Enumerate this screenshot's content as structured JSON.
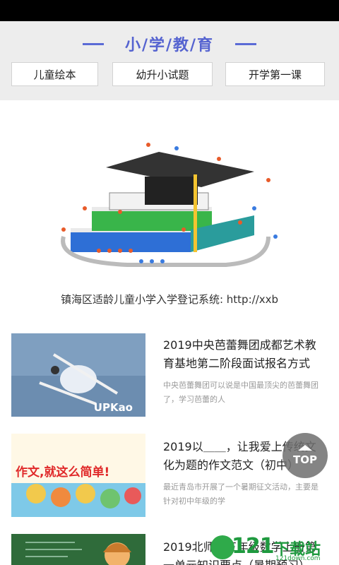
{
  "header": {
    "title": "小/学/教/育",
    "categories": [
      {
        "label": "儿童绘本"
      },
      {
        "label": "幼升小试题"
      },
      {
        "label": "开学第一课"
      }
    ]
  },
  "banner": {
    "caption": "镇海区适龄儿童小学入学登记系统: http://xxb"
  },
  "articles": [
    {
      "title": "2019中央芭蕾舞团成都艺术教育基地第二阶段面试报名方式",
      "desc": "中央芭蕾舞团可以说是中国最顶尖的芭蕾舞团了，学习芭蕾的人",
      "thumb_text": "UPKao"
    },
    {
      "title": "2019以＿＿，让我爱上传统文化为题的作文范文（初中）",
      "desc": "最近青岛市开展了一个暑期征文活动，主要是针对初中年级的学",
      "thumb_text": "作文,就这么简单!"
    },
    {
      "title": "2019北师大三年级数学上册第一单元知识要点（暑期预习）",
      "desc": "",
      "thumb_text": ""
    }
  ],
  "top_button": {
    "label": "TOP"
  },
  "watermark": {
    "num": "121",
    "text": "下载站",
    "url": "121down.com"
  },
  "colors": {
    "accent": "#5563d0",
    "header_bg": "#ededed",
    "muted_text": "#999999"
  }
}
